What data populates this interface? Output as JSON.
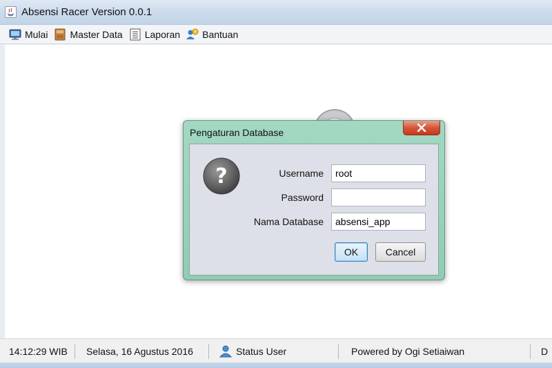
{
  "window": {
    "title": "Absensi Racer Version 0.0.1"
  },
  "menu": {
    "items": [
      {
        "label": "Mulai",
        "icon": "monitor-icon"
      },
      {
        "label": "Master Data",
        "icon": "folder-icon"
      },
      {
        "label": "Laporan",
        "icon": "report-list-icon"
      },
      {
        "label": "Bantuan",
        "icon": "help-people-icon"
      }
    ]
  },
  "dialog": {
    "title": "Pengaturan Database",
    "icon": "question-icon",
    "fields": {
      "username": {
        "label": "Username",
        "value": "root"
      },
      "password": {
        "label": "Password",
        "value": ""
      },
      "database": {
        "label": "Nama Database",
        "value": "absensi_app"
      }
    },
    "ok_label": "OK",
    "cancel_label": "Cancel"
  },
  "statusbar": {
    "time": "14:12:29 WIB",
    "date": "Selasa, 16 Agustus 2016",
    "user_status": "Status User",
    "powered_by": "Powered by Ogi Setiaiwan",
    "truncated": "D"
  },
  "colors": {
    "dialog_frame": "#8fcdb2",
    "close_button": "#d5553a",
    "ok_border": "#3c7fb1"
  }
}
